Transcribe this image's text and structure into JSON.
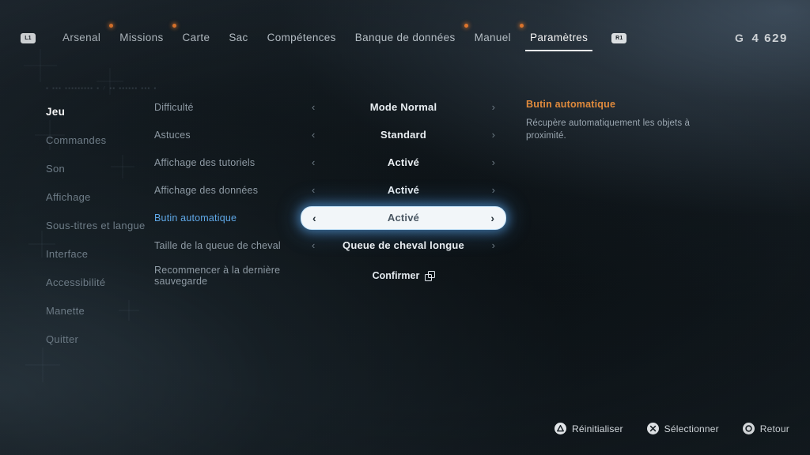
{
  "nav": {
    "left_bumper": "L1",
    "right_bumper": "R1",
    "items": [
      {
        "label": "Arsenal",
        "active": false,
        "dot": true
      },
      {
        "label": "Missions",
        "active": false,
        "dot": true
      },
      {
        "label": "Carte",
        "active": false,
        "dot": false
      },
      {
        "label": "Sac",
        "active": false,
        "dot": false
      },
      {
        "label": "Compétences",
        "active": false,
        "dot": false
      },
      {
        "label": "Banque de données",
        "active": false,
        "dot": true
      },
      {
        "label": "Manuel",
        "active": false,
        "dot": true
      },
      {
        "label": "Paramètres",
        "active": true,
        "dot": false
      }
    ]
  },
  "currency": {
    "symbol": "G",
    "amount": "4 629"
  },
  "sidebar": {
    "code_text": "▪ ▪▪▪ ▪▪▪▪▪▪▪▪▪ ▪ / ▪▪ ▪▪▪▪▪▪ ▪▪▪ ▪",
    "items": [
      {
        "label": "Jeu",
        "active": true
      },
      {
        "label": "Commandes",
        "active": false
      },
      {
        "label": "Son",
        "active": false
      },
      {
        "label": "Affichage",
        "active": false
      },
      {
        "label": "Sous-titres et langue",
        "active": false
      },
      {
        "label": "Interface",
        "active": false
      },
      {
        "label": "Accessibilité",
        "active": false
      },
      {
        "label": "Manette",
        "active": false
      },
      {
        "label": "Quitter",
        "active": false
      }
    ]
  },
  "settings": {
    "rows": [
      {
        "label": "Difficulté",
        "value": "Mode Normal",
        "type": "stepper",
        "selected": false
      },
      {
        "label": "Astuces",
        "value": "Standard",
        "type": "stepper",
        "selected": false
      },
      {
        "label": "Affichage des tutoriels",
        "value": "Activé",
        "type": "stepper",
        "selected": false
      },
      {
        "label": "Affichage des données",
        "value": "Activé",
        "type": "stepper",
        "selected": false
      },
      {
        "label": "Butin automatique",
        "value": "Activé",
        "type": "stepper",
        "selected": true
      },
      {
        "label": "Taille de la queue de cheval",
        "value": "Queue de cheval longue",
        "type": "stepper",
        "selected": false
      },
      {
        "label": "Recommencer à la dernière sauvegarde",
        "value": "Confirmer",
        "type": "action",
        "selected": false
      }
    ],
    "arrow_left": "‹",
    "arrow_right": "›"
  },
  "description": {
    "title": "Butin automatique",
    "body": "Récupère automatiquement les objets à proximité."
  },
  "prompts": [
    {
      "glyph": "triangle",
      "label": "Réinitialiser"
    },
    {
      "glyph": "cross",
      "label": "Sélectionner"
    },
    {
      "glyph": "circle",
      "label": "Retour"
    }
  ],
  "colors": {
    "accent_orange": "#e08a3c",
    "selection_blue": "#5fa8e8",
    "notification_dot": "#e87a2e",
    "text_primary": "#e9eef2",
    "text_muted": "#8e9aa4"
  }
}
